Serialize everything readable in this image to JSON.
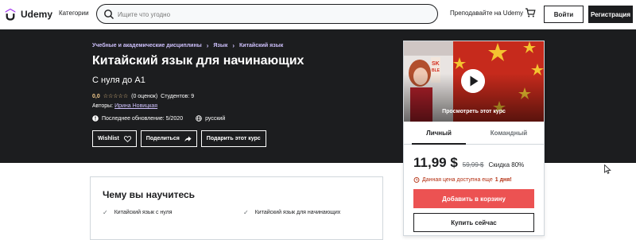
{
  "header": {
    "logo_text": "Udemy",
    "categories_label": "Категории",
    "search_placeholder": "Ищите что угодно",
    "teach_label": "Преподавайте на Udemy",
    "login_label": "Войти",
    "signup_label": "Регистрация",
    "icons": [
      "udemy-logo-icon",
      "search-icon",
      "cart-icon"
    ]
  },
  "hero": {
    "breadcrumb": [
      "Учебные и академические дисциплины",
      "Язык",
      "Китайский язык"
    ],
    "title": "Китайский язык для начинающих",
    "subtitle": "С нуля до А1",
    "rating_value": "0,0",
    "stars": "☆☆☆☆☆",
    "rating_count": "(0 оценок)",
    "students": "Студентов: 9",
    "authors_label": "Авторы:",
    "author_name": "Ирина Новицкая",
    "last_update": "Последнее обновление: 5/2020",
    "language": "русский",
    "buttons": {
      "wishlist": "Wishlist",
      "share": "Поделиться",
      "gift": "Подарить этот курс"
    }
  },
  "card": {
    "preview_label": "Просмотреть этот курс",
    "tabs": [
      "Личный",
      "Командный"
    ],
    "price": "11,99 $",
    "old_price": "59,99 $",
    "discount": "Скидка 80%",
    "deadline_text": "Данная цена доступна еще",
    "deadline_strong": "1 дня!",
    "add_to_cart": "Добавить в корзину",
    "buy_now": "Купить сейчас"
  },
  "learn": {
    "title": "Чему вы научитесь",
    "items": [
      "Китайский язык с нуля",
      "Китайский язык для начинающих"
    ]
  },
  "colors": {
    "dark": "#1c1d1f",
    "accent": "#ec5252",
    "link": "#cec0fc",
    "star": "#f3ca8c",
    "urgent": "#b32d0f"
  }
}
